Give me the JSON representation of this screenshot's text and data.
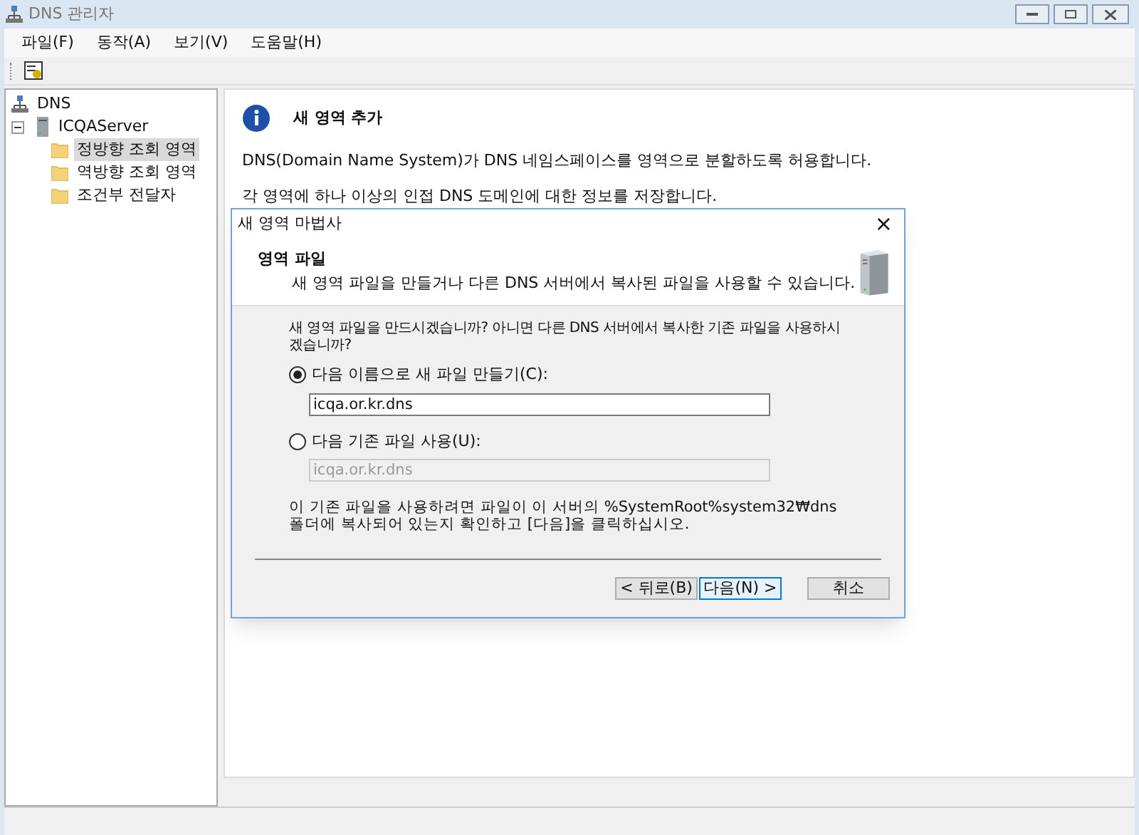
{
  "window": {
    "title": "DNS 관리자"
  },
  "menu": [
    "파일(F)",
    "동작(A)",
    "보기(V)",
    "도움말(H)"
  ],
  "tree": [
    {
      "label": "DNS",
      "kind": "root",
      "children": [
        {
          "label": "ICQAServer",
          "kind": "server",
          "expanded": true,
          "children": [
            {
              "label": "정방향 조회 영역",
              "kind": "folder",
              "selected": true
            },
            {
              "label": "역방향 조회 영역",
              "kind": "folder",
              "selected": false
            },
            {
              "label": "조건부 전달자",
              "kind": "folder",
              "selected": false
            }
          ]
        }
      ]
    }
  ],
  "info": {
    "title": "새 영역 추가",
    "lines": [
      "DNS(Domain Name System)가 DNS 네임스페이스를 영역으로 분할하도록 허용합니다.",
      "각 영역에 하나 이상의 인접 DNS 도메인에 대한 정보를 저장합니다."
    ]
  },
  "dialog": {
    "title": "새 영역 마법사",
    "close": "×",
    "heading": "영역 파일",
    "subheading": "새 영역 파일을 만들거나 다른 DNS 서버에서 복사된 파일을 사용할 수 있습니다.",
    "question": "새 영역 파일을 만드시겠습니까? 아니면 다른 DNS 서버에서 복사한 기존 파일을 사용하시겠습니까?",
    "options": [
      {
        "label": "다음 이름으로 새 파일 만들기(C):",
        "selected": true,
        "value": "icqa.or.kr.dns"
      },
      {
        "label": "다음 기존 파일 사용(U):",
        "selected": false,
        "value": "icqa.or.kr.dns"
      }
    ],
    "note": "이 기존 파일을 사용하려면 파일이 이 서버의 %SystemRoot%system32₩dns 폴더에 복사되어 있는지 확인하고 [다음]을 클릭하십시오.",
    "buttons": [
      {
        "label": "< 뒤로(B)",
        "kind": "normal"
      },
      {
        "label": "다음(N) >",
        "kind": "default"
      },
      {
        "label": "취소",
        "kind": "cancel"
      }
    ]
  }
}
